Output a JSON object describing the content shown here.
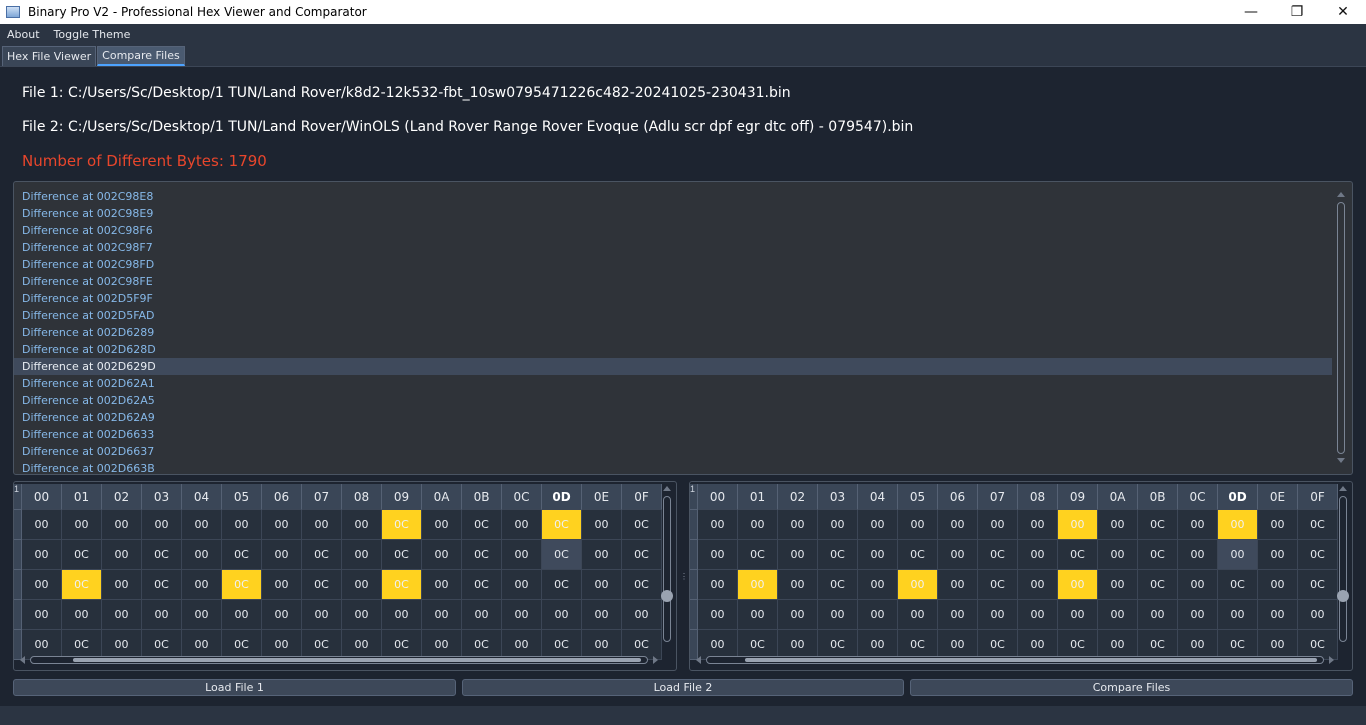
{
  "window": {
    "title": "Binary Pro V2 - Professional Hex Viewer and Comparator",
    "minimize": "—",
    "maximize": "❐",
    "close": "✕"
  },
  "menu": [
    {
      "label": "About"
    },
    {
      "label": "Toggle Theme"
    }
  ],
  "tabs": [
    {
      "label": "Hex File Viewer",
      "active": false
    },
    {
      "label": "Compare Files",
      "active": true
    }
  ],
  "compare": {
    "file1": "File 1: C:/Users/Sc/Desktop/1 TUN/Land Rover/k8d2-12k532-fbt_10sw0795471226c482-20241025-230431.bin",
    "file2": "File 2: C:/Users/Sc/Desktop/1 TUN/Land Rover/WinOLS (Land Rover Range Rover Evoque (Adlu scr dpf egr dtc off) - 079547).bin",
    "diff_count": "Number of Different Bytes: 1790",
    "differences": [
      "Difference at 002C98E8",
      "Difference at 002C98E9",
      "Difference at 002C98F6",
      "Difference at 002C98F7",
      "Difference at 002C98FD",
      "Difference at 002C98FE",
      "Difference at 002D5F9F",
      "Difference at 002D5FAD",
      "Difference at 002D6289",
      "Difference at 002D628D",
      "Difference at 002D629D",
      "Difference at 002D62A1",
      "Difference at 002D62A5",
      "Difference at 002D62A9",
      "Difference at 002D6633",
      "Difference at 002D6637",
      "Difference at 002D663B"
    ],
    "selected_index": 10
  },
  "hex": {
    "columns": [
      "00",
      "01",
      "02",
      "03",
      "04",
      "05",
      "06",
      "07",
      "08",
      "09",
      "0A",
      "0B",
      "0C",
      "0D",
      "0E",
      "0F"
    ],
    "bold_column": 13,
    "row_header_glyph": "1",
    "left": {
      "rows": [
        [
          "00",
          "00",
          "00",
          "00",
          "00",
          "00",
          "00",
          "00",
          "00",
          "0C",
          "00",
          "0C",
          "00",
          "0C",
          "00",
          "0C"
        ],
        [
          "00",
          "0C",
          "00",
          "0C",
          "00",
          "0C",
          "00",
          "0C",
          "00",
          "0C",
          "00",
          "0C",
          "00",
          "0C",
          "00",
          "0C"
        ],
        [
          "00",
          "0C",
          "00",
          "0C",
          "00",
          "0C",
          "00",
          "0C",
          "00",
          "0C",
          "00",
          "0C",
          "00",
          "0C",
          "00",
          "0C"
        ],
        [
          "00",
          "00",
          "00",
          "00",
          "00",
          "00",
          "00",
          "00",
          "00",
          "00",
          "00",
          "00",
          "00",
          "00",
          "00",
          "00"
        ],
        [
          "00",
          "0C",
          "00",
          "0C",
          "00",
          "0C",
          "00",
          "0C",
          "00",
          "0C",
          "00",
          "0C",
          "00",
          "0C",
          "00",
          "0C"
        ]
      ],
      "diff_cells": [
        [
          0,
          9
        ],
        [
          0,
          13
        ],
        [
          2,
          1
        ],
        [
          2,
          5
        ],
        [
          2,
          9
        ]
      ],
      "selected_cells": [
        [
          1,
          13
        ]
      ]
    },
    "right": {
      "rows": [
        [
          "00",
          "00",
          "00",
          "00",
          "00",
          "00",
          "00",
          "00",
          "00",
          "00",
          "00",
          "0C",
          "00",
          "00",
          "00",
          "0C"
        ],
        [
          "00",
          "0C",
          "00",
          "0C",
          "00",
          "0C",
          "00",
          "0C",
          "00",
          "0C",
          "00",
          "0C",
          "00",
          "00",
          "00",
          "0C"
        ],
        [
          "00",
          "00",
          "00",
          "0C",
          "00",
          "00",
          "00",
          "0C",
          "00",
          "00",
          "00",
          "0C",
          "00",
          "0C",
          "00",
          "0C"
        ],
        [
          "00",
          "00",
          "00",
          "00",
          "00",
          "00",
          "00",
          "00",
          "00",
          "00",
          "00",
          "00",
          "00",
          "00",
          "00",
          "00"
        ],
        [
          "00",
          "0C",
          "00",
          "0C",
          "00",
          "0C",
          "00",
          "0C",
          "00",
          "0C",
          "00",
          "0C",
          "00",
          "0C",
          "00",
          "0C"
        ]
      ],
      "diff_cells": [
        [
          0,
          9
        ],
        [
          0,
          13
        ],
        [
          2,
          1
        ],
        [
          2,
          5
        ],
        [
          2,
          9
        ]
      ],
      "selected_cells": [
        [
          1,
          13
        ]
      ]
    }
  },
  "buttons": {
    "load1": "Load File 1",
    "load2": "Load File 2",
    "compare": "Compare Files"
  },
  "colors": {
    "diff_highlight": "#ffd21f",
    "diff_count_text": "#e8462c",
    "list_text": "#86b8e8"
  }
}
